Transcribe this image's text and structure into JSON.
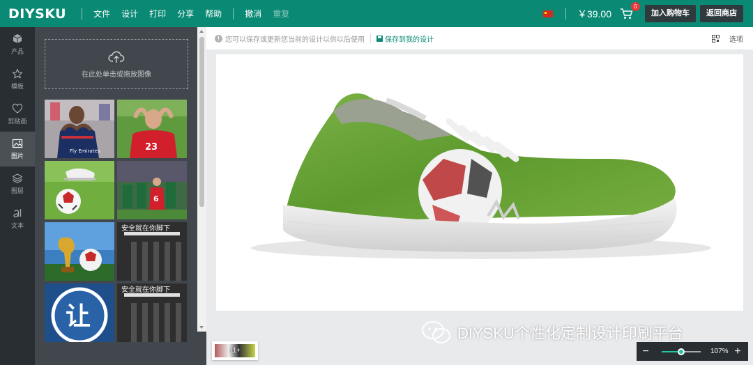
{
  "brand": {
    "logo": "DIYSKU"
  },
  "menu": {
    "file": "文件",
    "design": "设计",
    "print": "打印",
    "share": "分享",
    "help": "帮助",
    "undo": "撤消",
    "redo": "重复"
  },
  "cart": {
    "price": "￥39.00",
    "count": "0"
  },
  "actions": {
    "add_to_cart": "加入购物车",
    "back_to_shop": "返回商店"
  },
  "sidebar": {
    "items": [
      {
        "label": "产品",
        "icon": "cube-icon"
      },
      {
        "label": "模板",
        "icon": "star-icon"
      },
      {
        "label": "剪贴画",
        "icon": "heart-icon"
      },
      {
        "label": "图片",
        "icon": "image-icon",
        "active": true
      },
      {
        "label": "图层",
        "icon": "layers-icon"
      },
      {
        "label": "文本",
        "icon": "text-icon"
      }
    ]
  },
  "panel": {
    "upload_text": "在此处单击或拖放图像",
    "images": [
      {
        "name": "thumb-player-heart",
        "overlay": ""
      },
      {
        "name": "thumb-player-red",
        "overlay": ""
      },
      {
        "name": "thumb-football-boot",
        "overlay": ""
      },
      {
        "name": "thumb-russia-players",
        "overlay": ""
      },
      {
        "name": "thumb-world-cup-trophy",
        "overlay": ""
      },
      {
        "name": "thumb-safety-poster-1",
        "overlay": "安全就在你脚下"
      },
      {
        "name": "thumb-rang-sign",
        "overlay": "让"
      },
      {
        "name": "thumb-safety-poster-2",
        "overlay": "安全就在你脚下"
      }
    ]
  },
  "infobar": {
    "notice": "您可以保存或更新您当前的设计以供以后使用",
    "save_label": "保存到我的设计",
    "options_label": "选项"
  },
  "layer": {
    "badge": "11+"
  },
  "watermark": {
    "text": "DIYSKU个性化定制设计印刷平台"
  },
  "zoom": {
    "minus": "−",
    "plus": "+",
    "value": "107%",
    "level": 0.5
  },
  "colors": {
    "brand": "#0a8a74",
    "dark": "#292e32",
    "panel": "#41474c",
    "accent": "#23c3a3"
  }
}
